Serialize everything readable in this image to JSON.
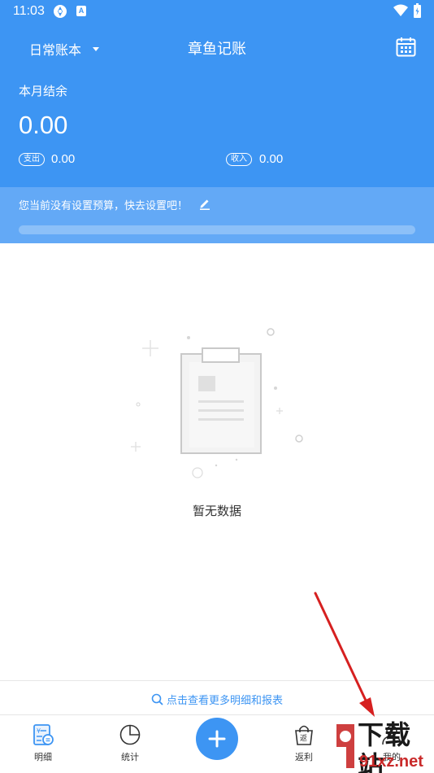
{
  "status_bar": {
    "time": "11:03"
  },
  "header": {
    "book_selector": "日常账本",
    "title": "章鱼记账",
    "balance_label": "本月结余",
    "balance_value": "0.00",
    "expense_tag": "支出",
    "expense_value": "0.00",
    "income_tag": "收入",
    "income_value": "0.00"
  },
  "budget": {
    "message": "您当前没有设置预算，快去设置吧！",
    "progress": 0
  },
  "empty_state": {
    "text": "暂无数据"
  },
  "footer_link": {
    "label": "点击查看更多明细和报表"
  },
  "bottom_nav": {
    "items": [
      {
        "label": "明细",
        "icon": "ledger-icon"
      },
      {
        "label": "统计",
        "icon": "pie-chart-icon"
      },
      {
        "label": "返利",
        "icon": "shopping-bag-icon"
      },
      {
        "label": "我的",
        "icon": "user-icon"
      }
    ],
    "fab_icon": "plus-icon"
  },
  "watermark": {
    "main": "下载站",
    "sub": "91xz.net"
  },
  "colors": {
    "primary": "#3d95f3",
    "budget_band": "#63a9f6",
    "annotation_arrow": "#d62020"
  }
}
